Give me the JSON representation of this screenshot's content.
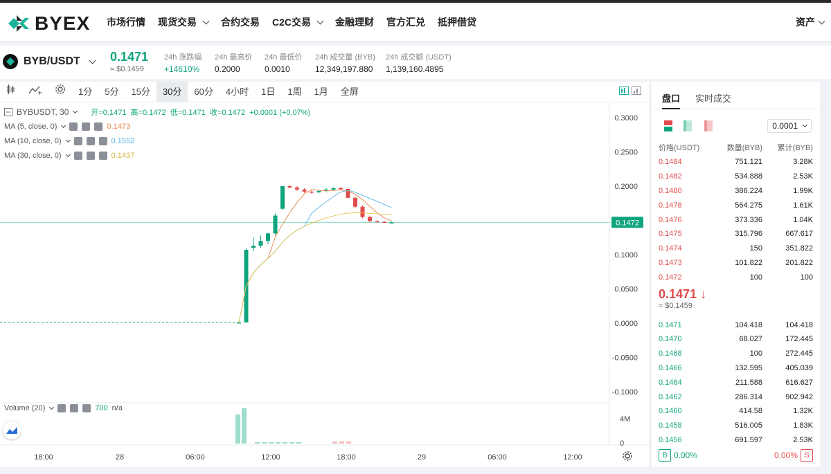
{
  "nav": {
    "brand": "BYEX",
    "items": [
      {
        "label": "市场行情",
        "dropdown": false
      },
      {
        "label": "现货交易",
        "dropdown": true
      },
      {
        "label": "合约交易",
        "dropdown": false
      },
      {
        "label": "C2C交易",
        "dropdown": true
      },
      {
        "label": "金融理财",
        "dropdown": false
      },
      {
        "label": "官方汇兑",
        "dropdown": false
      },
      {
        "label": "抵押借贷",
        "dropdown": false
      }
    ],
    "right": "资产"
  },
  "ticker": {
    "pair": "BYB/USDT",
    "last": "0.1471",
    "last_usd": "≈ $0.1459",
    "stats": [
      {
        "label": "24h 涨跌幅",
        "value": "+14610%",
        "color": "#0fa47e"
      },
      {
        "label": "24h 最高价",
        "value": "0.2000"
      },
      {
        "label": "24h 最低价",
        "value": "0.0010"
      },
      {
        "label": "24h 成交量 (BYB)",
        "value": "12,349,197.880"
      },
      {
        "label": "24h 成交额 (USDT)",
        "value": "1,139,160.4895"
      }
    ]
  },
  "toolbar": {
    "intervals": [
      "1分",
      "5分",
      "15分",
      "30分",
      "60分",
      "4小时",
      "1日",
      "1周",
      "1月",
      "全屏"
    ],
    "active": "30分"
  },
  "legend": {
    "symbol": "BYBUSDT, 30",
    "ohlc": "开=0.1471  高=0.1472  低=0.1471  收=0.1472  +0.0001 (+0.07%)",
    "ma5": {
      "label": "MA (5, close, 0)",
      "value": "0.1473",
      "color": "#e8884a"
    },
    "ma10": {
      "label": "MA (10, close, 0)",
      "value": "0.1552",
      "color": "#52b6e6"
    },
    "ma30": {
      "label": "MA (30, close, 0)",
      "value": "0.1437",
      "color": "#e8c44a"
    },
    "volume": {
      "label": "Volume (20)",
      "value": "700",
      "na": "n/a"
    }
  },
  "chart_data": {
    "type": "candlestick",
    "interval": "30分",
    "y_ticks": [
      "0.3000",
      "0.2500",
      "0.2000",
      "0.1500",
      "0.1000",
      "0.0500",
      "0.0000",
      "-0.0500",
      "-0.1000"
    ],
    "ylim": [
      -0.1,
      0.3
    ],
    "last_price_label": "0.1472",
    "last_price": 0.1472,
    "x_labels": [
      "18:00",
      "28",
      "06:00",
      "12:00",
      "18:00",
      "29",
      "06:00",
      "12:00"
    ],
    "volume_ticks": [
      "4M",
      "0"
    ],
    "candles": [
      {
        "t": 0,
        "o": 0.001,
        "h": 0.001,
        "l": 0.001,
        "c": 0.001
      },
      {
        "t": 1,
        "o": 0.001,
        "h": 0.11,
        "l": 0.001,
        "c": 0.107
      },
      {
        "t": 2,
        "o": 0.11,
        "h": 0.125,
        "l": 0.105,
        "c": 0.113
      },
      {
        "t": 3,
        "o": 0.113,
        "h": 0.128,
        "l": 0.11,
        "c": 0.12
      },
      {
        "t": 4,
        "o": 0.12,
        "h": 0.132,
        "l": 0.115,
        "c": 0.131
      },
      {
        "t": 5,
        "o": 0.131,
        "h": 0.16,
        "l": 0.128,
        "c": 0.157
      },
      {
        "t": 6,
        "o": 0.167,
        "h": 0.2,
        "l": 0.165,
        "c": 0.2
      },
      {
        "t": 7,
        "o": 0.2,
        "h": 0.201,
        "l": 0.197,
        "c": 0.198
      },
      {
        "t": 8,
        "o": 0.198,
        "h": 0.2,
        "l": 0.193,
        "c": 0.195
      },
      {
        "t": 9,
        "o": 0.195,
        "h": 0.197,
        "l": 0.19,
        "c": 0.192
      },
      {
        "t": 10,
        "o": 0.192,
        "h": 0.194,
        "l": 0.189,
        "c": 0.191
      },
      {
        "t": 11,
        "o": 0.191,
        "h": 0.194,
        "l": 0.189,
        "c": 0.193
      },
      {
        "t": 12,
        "o": 0.193,
        "h": 0.197,
        "l": 0.191,
        "c": 0.195
      },
      {
        "t": 13,
        "o": 0.195,
        "h": 0.198,
        "l": 0.194,
        "c": 0.197
      },
      {
        "t": 14,
        "o": 0.197,
        "h": 0.199,
        "l": 0.195,
        "c": 0.196
      },
      {
        "t": 15,
        "o": 0.196,
        "h": 0.198,
        "l": 0.182,
        "c": 0.183
      },
      {
        "t": 16,
        "o": 0.183,
        "h": 0.185,
        "l": 0.168,
        "c": 0.17
      },
      {
        "t": 17,
        "o": 0.17,
        "h": 0.172,
        "l": 0.153,
        "c": 0.155
      },
      {
        "t": 18,
        "o": 0.155,
        "h": 0.157,
        "l": 0.147,
        "c": 0.149
      },
      {
        "t": 19,
        "o": 0.149,
        "h": 0.15,
        "l": 0.146,
        "c": 0.148
      },
      {
        "t": 20,
        "o": 0.148,
        "h": 0.149,
        "l": 0.146,
        "c": 0.147
      },
      {
        "t": 21,
        "o": 0.147,
        "h": 0.148,
        "l": 0.146,
        "c": 0.147
      }
    ]
  },
  "book": {
    "tabs": [
      "盘口",
      "实时成交"
    ],
    "precision": "0.0001",
    "headers": [
      "价格(USDT)",
      "数量(BYB)",
      "累计(BYB)"
    ],
    "asks": [
      [
        "0.1484",
        "751.121",
        "3.28K"
      ],
      [
        "0.1482",
        "534.888",
        "2.53K"
      ],
      [
        "0.1480",
        "386.224",
        "1.99K"
      ],
      [
        "0.1478",
        "564.275",
        "1.61K"
      ],
      [
        "0.1476",
        "373.336",
        "1.04K"
      ],
      [
        "0.1475",
        "315.796",
        "667.617"
      ],
      [
        "0.1474",
        "150",
        "351.822"
      ],
      [
        "0.1473",
        "101.822",
        "201.822"
      ],
      [
        "0.1472",
        "100",
        "100"
      ]
    ],
    "mid": "0.1471",
    "mid_usd": "≈ $0.1459",
    "bids": [
      [
        "0.1471",
        "104.418",
        "104.418"
      ],
      [
        "0.1470",
        "68.027",
        "172.445"
      ],
      [
        "0.1468",
        "100",
        "272.445"
      ],
      [
        "0.1466",
        "132.595",
        "405.039"
      ],
      [
        "0.1464",
        "211.588",
        "616.627"
      ],
      [
        "0.1462",
        "286.314",
        "902.942"
      ],
      [
        "0.1460",
        "414.58",
        "1.32K"
      ],
      [
        "0.1458",
        "516.005",
        "1.83K"
      ],
      [
        "0.1456",
        "691.597",
        "2.53K"
      ]
    ],
    "buy_pct": "0.00%",
    "sell_pct": "0.00%",
    "buy_tag": "B",
    "sell_tag": "S"
  },
  "colors": {
    "up": "#0fa47e",
    "down": "#e04b4b"
  }
}
